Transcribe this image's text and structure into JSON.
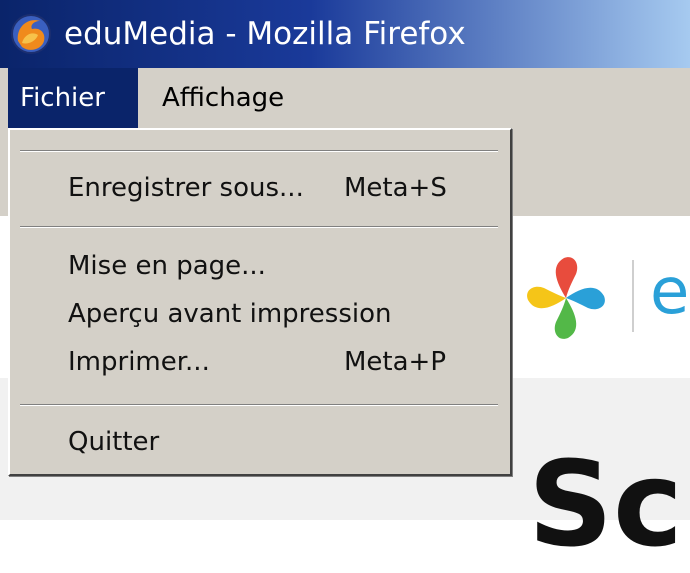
{
  "window": {
    "title": "eduMedia - Mozilla Firefox",
    "app_icon": "firefox-icon"
  },
  "menubar": {
    "items": [
      {
        "label": "Fichier",
        "active": true
      },
      {
        "label": "Affichage",
        "active": false
      }
    ]
  },
  "dropdown": {
    "items": [
      {
        "label": "Enregistrer sous...",
        "shortcut": "Meta+S"
      },
      {
        "label": "Mise en page...",
        "shortcut": ""
      },
      {
        "label": "Aperçu avant impression",
        "shortcut": ""
      },
      {
        "label": "Imprimer...",
        "shortcut": "Meta+P"
      },
      {
        "label": "Quitter",
        "shortcut": ""
      }
    ]
  },
  "page": {
    "logo_icon": "edumedia-pinwheel-icon",
    "logo_letter": "e",
    "heading_fragment": "Sci"
  },
  "colors": {
    "title_bar": "#0a246a",
    "menu_bg": "#d4d0c8",
    "menu_highlight": "#0a246a",
    "logo_accent": "#2aa0d8"
  }
}
